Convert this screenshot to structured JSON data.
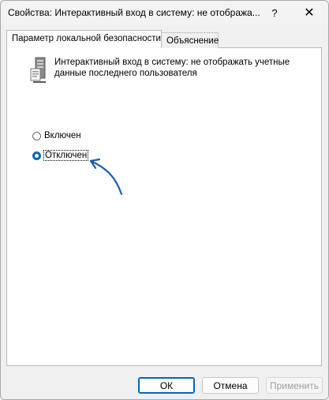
{
  "window": {
    "title": "Свойства: Интерактивный вход в систему: не отобража...",
    "help_label": "?",
    "close_label": "✕"
  },
  "tabs": [
    {
      "label": "Параметр локальной безопасности",
      "active": true
    },
    {
      "label": "Объяснение",
      "active": false
    }
  ],
  "policy": {
    "description": "Интерактивный вход в систему: не отображать учетные данные последнего пользователя",
    "icon": "server-policy-icon"
  },
  "options": [
    {
      "label": "Включен",
      "selected": false
    },
    {
      "label": "Отключен",
      "selected": true
    }
  ],
  "buttons": {
    "ok": "ОК",
    "cancel": "Отмена",
    "apply": "Применить"
  },
  "colors": {
    "accent": "#0067c0",
    "annotation_arrow": "#1f5ea8"
  }
}
